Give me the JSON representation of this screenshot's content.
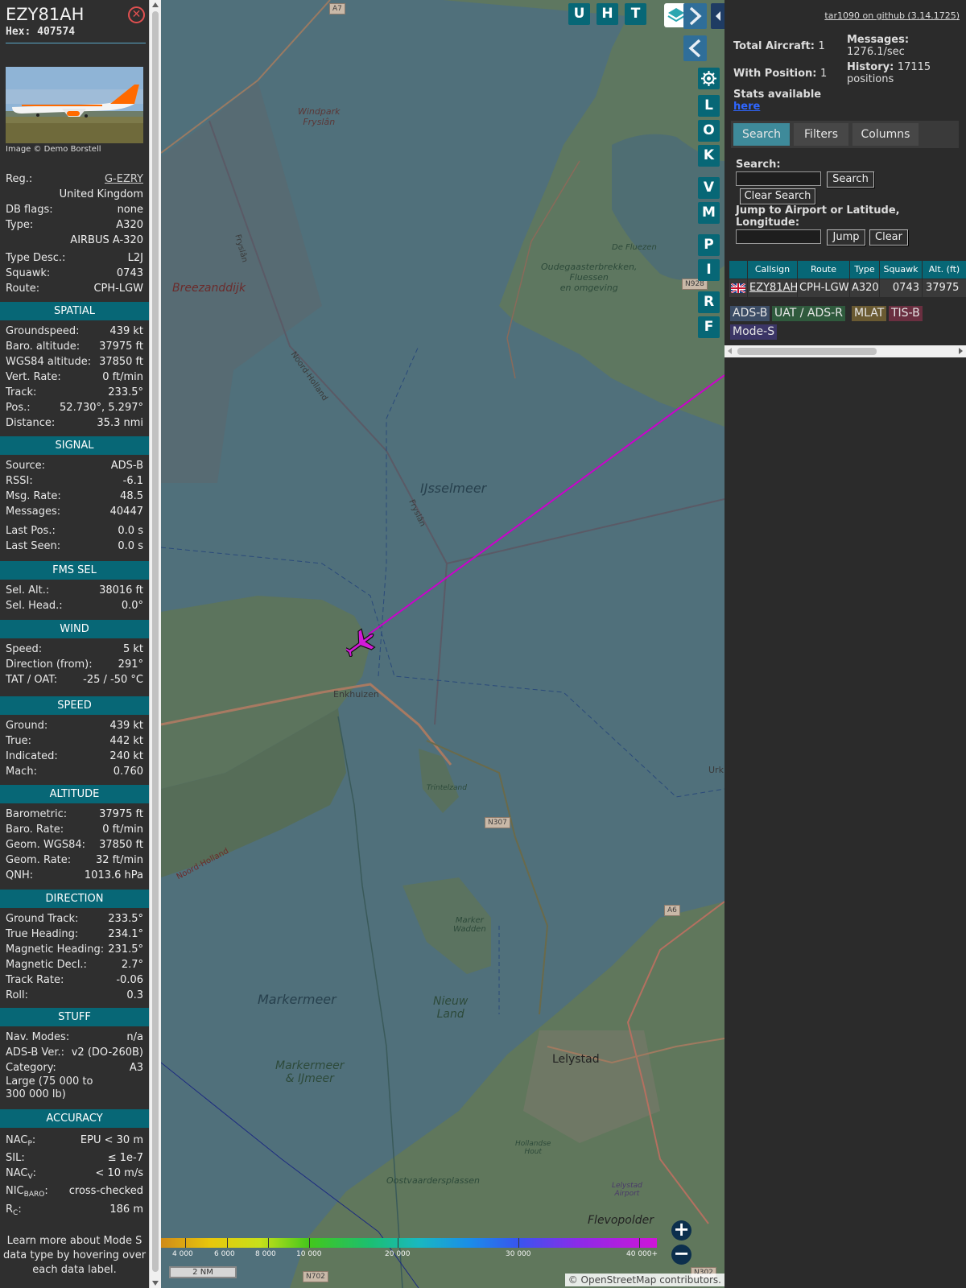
{
  "aircraft": {
    "callsign": "EZY81AH",
    "hex": "Hex: 407574",
    "photo_credit": "Image © Demo Borstell"
  },
  "info_rows": [
    {
      "k": "Reg.:",
      "v": "G-EZRY"
    },
    {
      "k": "",
      "v": "United Kingdom"
    },
    {
      "k": "DB flags:",
      "v": "none"
    },
    {
      "k": "Type:",
      "v": "A320"
    },
    {
      "k": "",
      "v": "AIRBUS A-320"
    },
    {
      "k": "Type Desc.:",
      "v": "L2J"
    },
    {
      "k": "Squawk:",
      "v": "0743"
    },
    {
      "k": "Route:",
      "v": "CPH-LGW"
    }
  ],
  "sections": {
    "spatial": "SPATIAL",
    "signal": "SIGNAL",
    "fms": "FMS SEL",
    "wind": "WIND",
    "speed": "SPEED",
    "altitude": "ALTITUDE",
    "direction": "DIRECTION",
    "stuff": "STUFF",
    "accuracy": "ACCURACY"
  },
  "spatial": [
    {
      "k": "Groundspeed:",
      "v": "439 kt"
    },
    {
      "k": "Baro. altitude:",
      "v": "37975 ft"
    },
    {
      "k": "WGS84 altitude:",
      "v": "37850 ft"
    },
    {
      "k": "Vert. Rate:",
      "v": "0 ft/min"
    },
    {
      "k": "Track:",
      "v": "233.5°"
    },
    {
      "k": "Pos.:",
      "v": "52.730°, 5.297°"
    },
    {
      "k": "Distance:",
      "v": "35.3 nmi"
    }
  ],
  "signal": [
    {
      "k": "Source:",
      "v": "ADS-B"
    },
    {
      "k": "RSSI:",
      "v": "-6.1"
    },
    {
      "k": "Msg. Rate:",
      "v": "48.5"
    },
    {
      "k": "Messages:",
      "v": "40447"
    },
    {
      "k": "Last Pos.:",
      "v": "0.0 s"
    },
    {
      "k": "Last Seen:",
      "v": "0.0 s"
    }
  ],
  "fms": [
    {
      "k": "Sel. Alt.:",
      "v": "38016 ft"
    },
    {
      "k": "Sel. Head.:",
      "v": "0.0°"
    }
  ],
  "wind": [
    {
      "k": "Speed:",
      "v": "5 kt"
    },
    {
      "k": "Direction (from):",
      "v": "291°"
    },
    {
      "k": "TAT / OAT:",
      "v": "-25 / -50 °C"
    }
  ],
  "speed": [
    {
      "k": "Ground:",
      "v": "439 kt"
    },
    {
      "k": "True:",
      "v": "442 kt"
    },
    {
      "k": "Indicated:",
      "v": "240 kt"
    },
    {
      "k": "Mach:",
      "v": "0.760"
    }
  ],
  "altitude": [
    {
      "k": "Barometric:",
      "v": "37975 ft"
    },
    {
      "k": "Baro. Rate:",
      "v": "0 ft/min"
    },
    {
      "k": "Geom. WGS84:",
      "v": "37850 ft"
    },
    {
      "k": "Geom. Rate:",
      "v": "32 ft/min"
    },
    {
      "k": "QNH:",
      "v": "1013.6 hPa"
    }
  ],
  "direction": [
    {
      "k": "Ground Track:",
      "v": "233.5°"
    },
    {
      "k": "True Heading:",
      "v": "234.1°"
    },
    {
      "k": "Magnetic Heading:",
      "v": "231.5°"
    },
    {
      "k": "Magnetic Decl.:",
      "v": "2.7°"
    },
    {
      "k": "Track Rate:",
      "v": "-0.06"
    },
    {
      "k": "Roll:",
      "v": "0.3"
    }
  ],
  "stuff": [
    {
      "k": "Nav. Modes:",
      "v": "n/a"
    },
    {
      "k": "ADS-B Ver.:",
      "v": "v2 (DO-260B)"
    },
    {
      "k": "Category:",
      "v": "A3"
    },
    {
      "k": "Large (75 000 to 300 000 lb)",
      "v": ""
    }
  ],
  "accuracy": [
    {
      "k": "NAC",
      "sub": "P",
      "tail": ":",
      "v": "EPU < 30 m"
    },
    {
      "k": "SIL:",
      "sub": "",
      "tail": "",
      "v": "≤ 1e-7"
    },
    {
      "k": "NAC",
      "sub": "V",
      "tail": ":",
      "v": "< 10 m/s"
    },
    {
      "k": "NIC",
      "sub": "BARO",
      "tail": ":",
      "v": "cross-checked"
    },
    {
      "k": "R",
      "sub": "C",
      "tail": ":",
      "v": "186 m"
    }
  ],
  "footer_note": "Learn more about Mode S data type by hovering over each data label.",
  "map": {
    "labels": {
      "windpark": "Windpark\nFryslân",
      "breezanddijk": "Breezanddijk",
      "fryslan1": "Fryslân",
      "noordholland1": "Noord-Holland",
      "ijsselmeer": "IJsselmeer",
      "fryslan2": "Fryslân",
      "oudega": "Oudegaasterbrekken,\nFluessen\nen omgeving",
      "defluezen": "De Fluezen",
      "enkhuizen": "Enkhuizen",
      "trintelzand": "Trintelzand",
      "noordholland2": "Noord-Holland",
      "markerwadden": "Marker\nWadden",
      "markermeer": "Markermeer",
      "nieuwland": "Nieuw\nLand",
      "markermeer_ij": "Markermeer\n& IJmeer",
      "lelystad": "Lelystad",
      "hollandsehout": "Hollandse\nHout",
      "oostvaardersplassen": "Oostvaardersplassen",
      "lelystad_airport": "Lelystad\nAirport",
      "flevopolder": "Flevopolder",
      "urk": "Urk"
    },
    "shields": {
      "a7": "A7",
      "n928": "N928",
      "n307": "N307",
      "a6": "A6",
      "n702": "N702",
      "n302": "N302"
    },
    "toolbar_buttons": [
      "U",
      "H",
      "T"
    ],
    "side_buttons": [
      "L",
      "O",
      "K",
      "V",
      "M",
      "P",
      "I",
      "R",
      "F"
    ],
    "alt_scale": [
      "4 000",
      "6 000",
      "8 000",
      "10 000",
      "20 000",
      "30 000",
      "40 000+"
    ],
    "scale_label": "2 NM",
    "attribution": "© OpenStreetMap contributors.",
    "zoom_in": "+",
    "zoom_out": "−",
    "track_color": "#cc00cc"
  },
  "panel": {
    "source_link": "tar1090 on github (3.14.1725)",
    "total_aircraft_label": "Total Aircraft:",
    "total_aircraft": "1",
    "with_position_label": "With Position:",
    "with_position": "1",
    "messages_label": "Messages:",
    "messages_rate": "1276.1/sec",
    "history_label": "History:",
    "history_value": "17115 positions",
    "stats_label": "Stats available",
    "stats_link": "here",
    "tabs": [
      "Search",
      "Filters",
      "Columns"
    ],
    "search_label": "Search:",
    "search_button": "Search",
    "clear_search_button": "Clear Search",
    "jump_label": "Jump to Airport or Latitude, Longitude:",
    "jump_button": "Jump",
    "clear_button": "Clear",
    "table_headers": [
      "",
      "Callsign",
      "Route",
      "Type",
      "Squawk",
      "Alt. (ft)"
    ],
    "table_row": {
      "flag": "GB",
      "callsign": "EZY81AH",
      "route": "CPH-LGW",
      "type": "A320",
      "squawk": "0743",
      "alt": "37975"
    },
    "legend": [
      {
        "label": "ADS-B",
        "color": "#3c4d66"
      },
      {
        "label": "UAT / ADS-R",
        "color": "#2f5a3d"
      },
      {
        "label": "MLAT",
        "color": "#6a5a32"
      },
      {
        "label": "TIS-B",
        "color": "#6a2f40"
      },
      {
        "label": "Mode-S",
        "color": "#3b3566"
      }
    ]
  }
}
